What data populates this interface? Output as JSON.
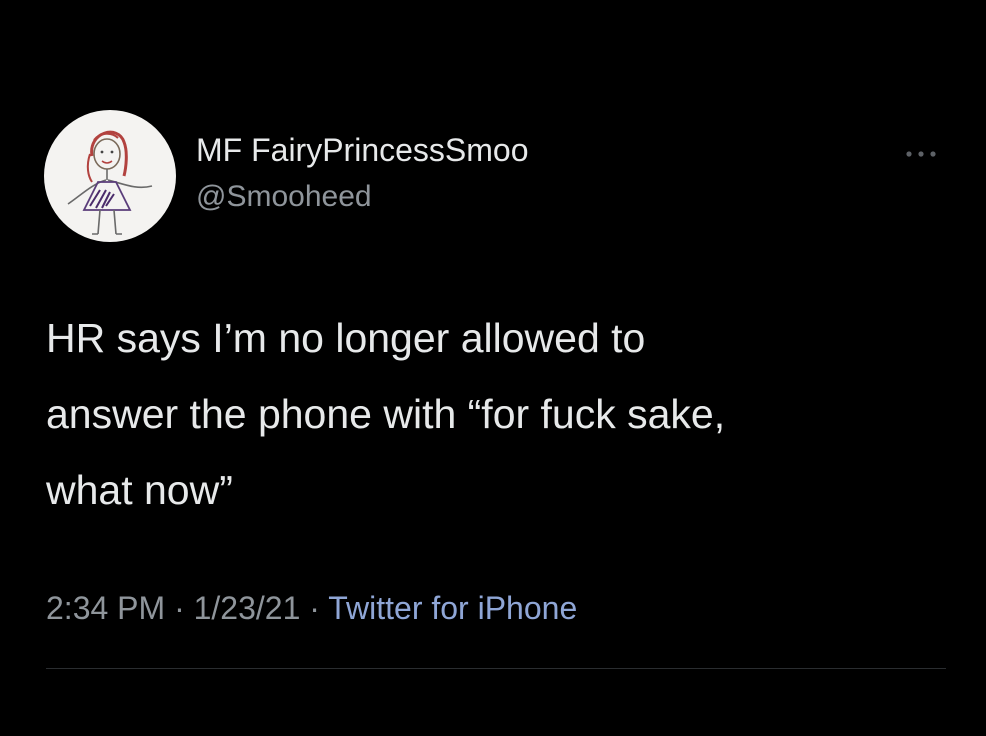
{
  "tweet": {
    "author": {
      "display_name": "MF FairyPrincessSmoo",
      "handle": "@Smooheed",
      "avatar_icon": "stick-figure-drawing-avatar"
    },
    "text_lines": [
      "HR says I’m no longer allowed to",
      "answer the phone with “for fuck sake,",
      "what now”"
    ],
    "time": "2:34 PM",
    "separator": "·",
    "date": "1/23/21",
    "source": "Twitter for iPhone",
    "more_icon": "more-options-icon"
  },
  "colors": {
    "background": "#000000",
    "primary_text": "#e7e9ea",
    "secondary_text": "#8f959b",
    "source_link": "#8fa6d6",
    "avatar_bg": "#f4f3f1"
  }
}
